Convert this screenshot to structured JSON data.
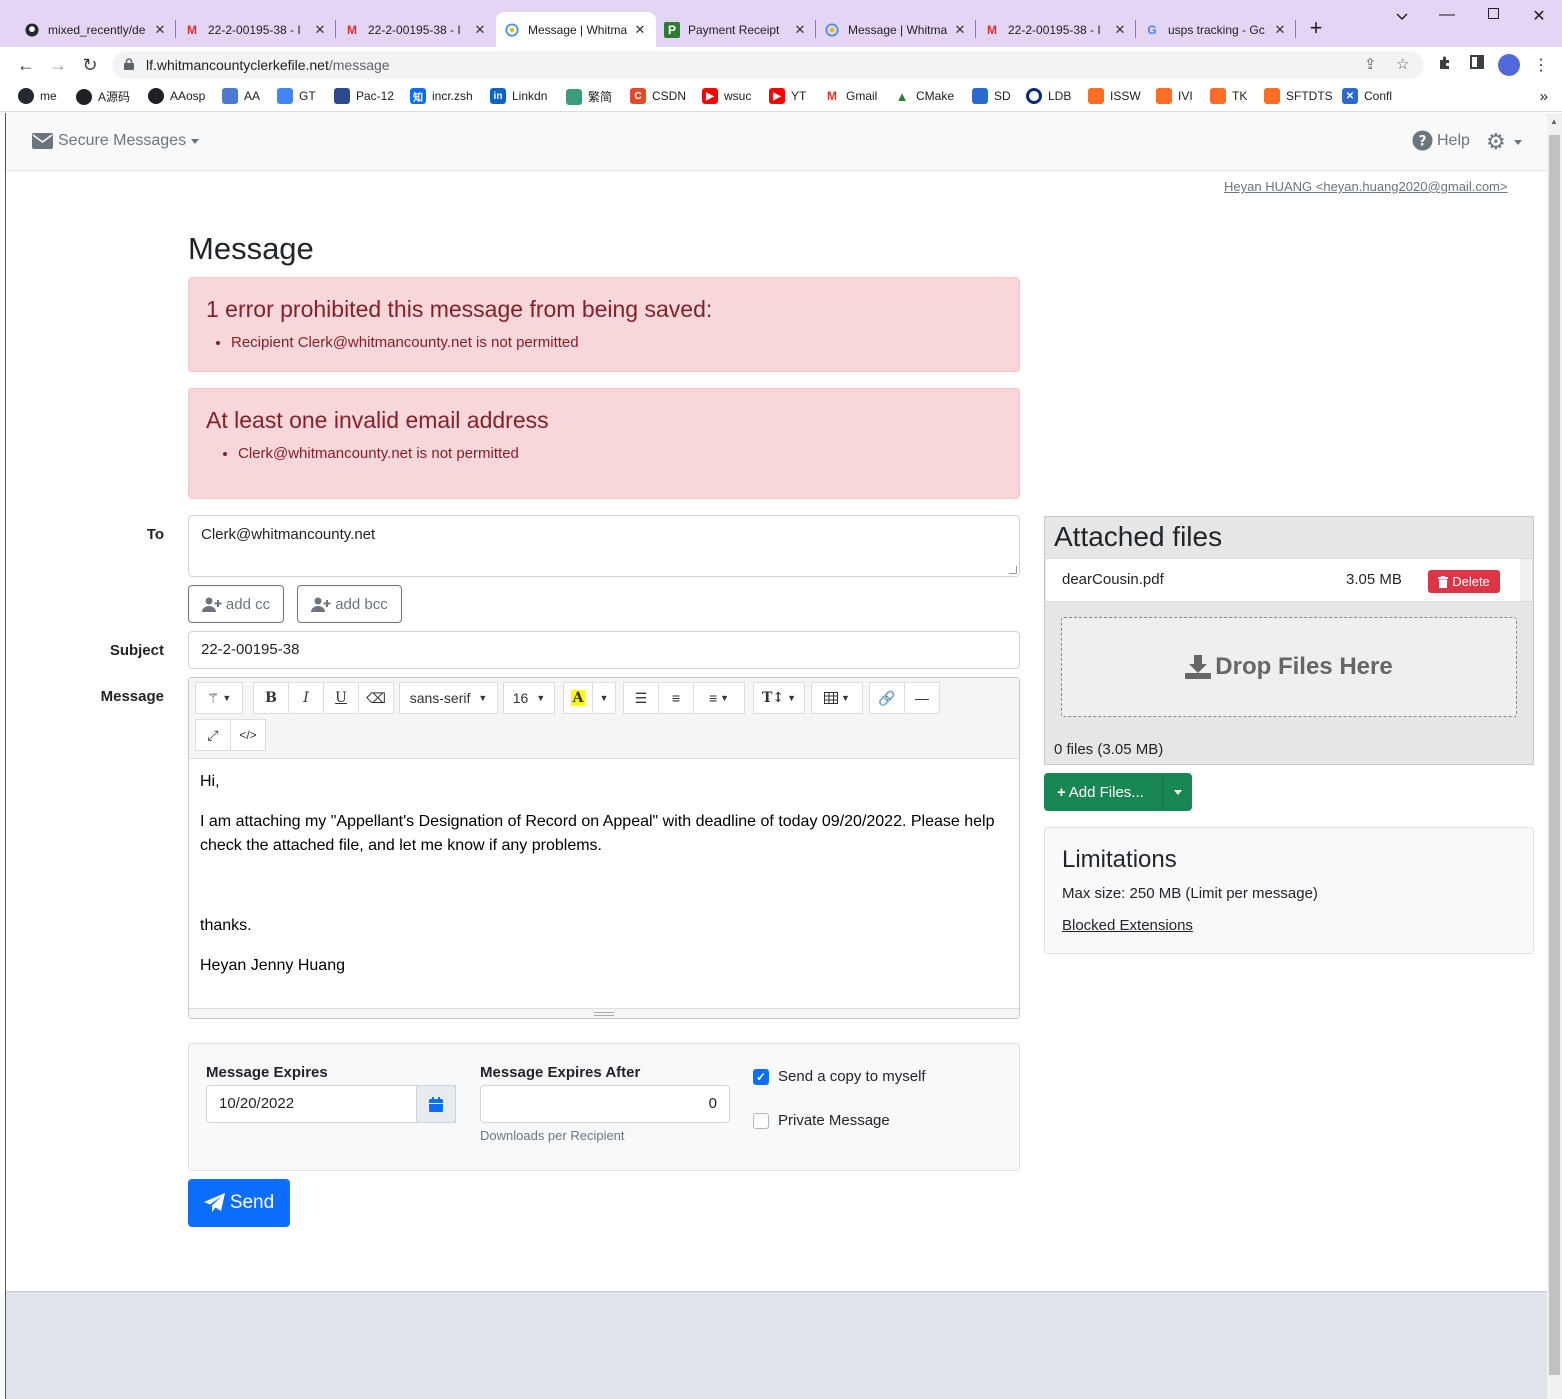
{
  "browser": {
    "tabs": [
      {
        "title": "mixed_recently/de",
        "icon": "github-icon",
        "active": false
      },
      {
        "title": "22-2-00195-38 - I",
        "icon": "gmail-icon",
        "active": false
      },
      {
        "title": "22-2-00195-38 - I",
        "icon": "gmail-icon",
        "active": false
      },
      {
        "title": "Message | Whitma",
        "icon": "lf-icon",
        "active": true
      },
      {
        "title": "Payment Receipt",
        "icon": "p-icon",
        "active": false
      },
      {
        "title": "Message | Whitma",
        "icon": "lf-icon",
        "active": false
      },
      {
        "title": "22-2-00195-38 - I",
        "icon": "gmail-icon",
        "active": false
      },
      {
        "title": "usps tracking - Gc",
        "icon": "google-icon",
        "active": false
      }
    ],
    "url_host": "lf.whitmancountyclerkefile.net",
    "url_path": "/message",
    "bookmarks": [
      "me",
      "A源码",
      "AAosp",
      "AA",
      "GT",
      "Pac-12",
      "incr.zsh",
      "Linkdn",
      "繁简",
      "CSDN",
      "wsuc",
      "YT",
      "Gmail",
      "CMake",
      "SD",
      "LDB",
      "ISSW",
      "IVI",
      "TK",
      "SFTDTS",
      "Confl"
    ],
    "bookmark_colors": [
      "#24292f",
      "#202124",
      "#202124",
      "#4a7bd0",
      "#4285f4",
      "#2a4a8a",
      "#0d6efd",
      "#0a66c2",
      "#3a9c7a",
      "#e24b2a",
      "#ff0000",
      "#ff0000",
      "#d93025",
      "#2a7a3a",
      "#2a6ad0",
      "#0a2a7a",
      "#fc6d26",
      "#fc6d26",
      "#fc6d26",
      "#fc6d26",
      "#2a6ad0"
    ]
  },
  "app": {
    "nav_brand": "Secure Messages",
    "help_label": "Help",
    "user": "Heyan HUANG <heyan.huang2020@gmail.com>"
  },
  "page": {
    "title": "Message",
    "alert1": {
      "heading": "1 error prohibited this message from being saved:",
      "items": [
        "Recipient Clerk@whitmancounty.net is not permitted"
      ]
    },
    "alert2": {
      "heading": "At least one invalid email address",
      "items": [
        "Clerk@whitmancounty.net is not permitted"
      ]
    },
    "form": {
      "to_label": "To",
      "to_value": "Clerk@whitmancounty.net",
      "add_cc": "add cc",
      "add_bcc": "add bcc",
      "subject_label": "Subject",
      "subject_value": "22-2-00195-38",
      "message_label": "Message",
      "font_name": "sans-serif",
      "font_size": "16",
      "body": [
        "Hi,",
        "I am attaching my \"Appellant's Designation of Record on Appeal\" with deadline of today 09/20/2022. Please help check the attached file, and let me know if any problems.",
        "",
        "thanks.",
        "Heyan Jenny Huang"
      ]
    },
    "options": {
      "expires_label": "Message Expires",
      "expires_value": "10/20/2022",
      "expires_after_label": "Message Expires After",
      "expires_after_value": "0",
      "expires_after_help": "Downloads per Recipient",
      "copy_label": "Send a copy to myself",
      "copy_checked": true,
      "private_label": "Private Message",
      "private_checked": false
    },
    "send_label": "Send"
  },
  "attachments": {
    "title": "Attached files",
    "files": [
      {
        "name": "dearCousin.pdf",
        "size": "3.05 MB",
        "delete_label": "Delete"
      }
    ],
    "drop_label": "Drop Files Here",
    "count_label": "0 files (3.05 MB)",
    "add_label": "Add Files..."
  },
  "limitations": {
    "title": "Limitations",
    "max_size": "Max size: 250 MB (Limit per message)",
    "blocked_label": "Blocked Extensions"
  },
  "colors": {
    "primary": "#0d6efd",
    "danger": "#dc3545",
    "success": "#198754",
    "alert_bg": "#f8d7da",
    "alert_text": "#842029"
  }
}
